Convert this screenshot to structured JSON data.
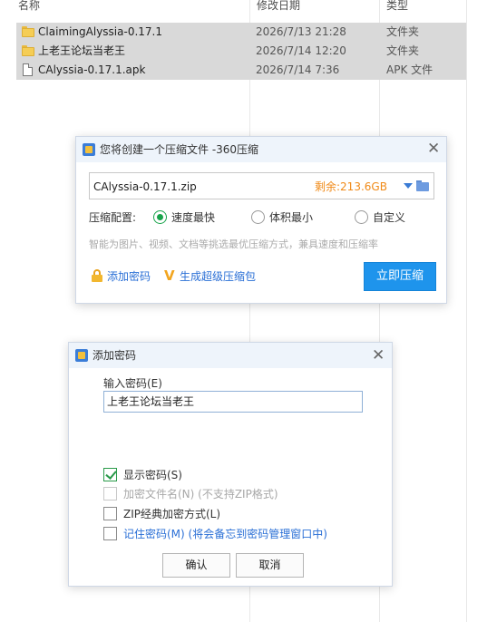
{
  "explorer": {
    "columns": {
      "name": "名称",
      "date": "修改日期",
      "type": "类型"
    },
    "files": [
      {
        "icon": "folder-icon",
        "name": "ClaimingAlyssia-0.17.1",
        "date": "2026/7/13 21:28",
        "type": "文件夹"
      },
      {
        "icon": "folder-icon",
        "name": "上老王论坛当老王",
        "date": "2026/7/14 12:20",
        "type": "文件夹"
      },
      {
        "icon": "file-icon",
        "name": "CAlyssia-0.17.1.apk",
        "date": "2026/7/14 7:36",
        "type": "APK 文件"
      }
    ]
  },
  "zip_dialog": {
    "title": "您将创建一个压缩文件 -360压缩",
    "filename": "CAlyssia-0.17.1.zip",
    "remaining": "剩余:213.6GB",
    "config_label": "压缩配置:",
    "options": [
      {
        "label": "速度最快",
        "selected": true
      },
      {
        "label": "体积最小",
        "selected": false
      },
      {
        "label": "自定义",
        "selected": false
      }
    ],
    "hint": "智能为图片、视频、文档等挑选最优压缩方式，兼具速度和压缩率",
    "add_password": "添加密码",
    "super_zip": "生成超级压缩包",
    "compress_button": "立即压缩"
  },
  "password_dialog": {
    "title": "添加密码",
    "input_label": "输入密码(E)",
    "password_value": "上老王论坛当老王",
    "options": [
      {
        "label": "显示密码(S)",
        "checked": true,
        "enabled": true
      },
      {
        "label": "加密文件名(N)  (不支持ZIP格式)",
        "checked": false,
        "enabled": false
      },
      {
        "label": "ZIP经典加密方式(L)",
        "checked": false,
        "enabled": true
      },
      {
        "label": "记住密码(M)  (将会备忘到密码管理窗口中)",
        "checked": false,
        "enabled": true
      }
    ],
    "ok_button": "确认",
    "cancel_button": "取消"
  }
}
